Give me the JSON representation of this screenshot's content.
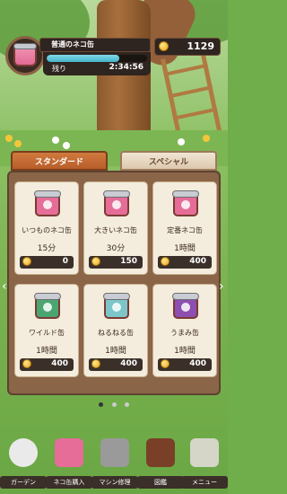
{
  "header": {
    "can_title": "普通のネコ缶",
    "remaining_label": "残り",
    "remaining_time": "2:34:56",
    "progress": 0.72,
    "coins": "1129"
  },
  "tabs": [
    {
      "label": "スタンダード",
      "active": true
    },
    {
      "label": "スペシャル",
      "active": false
    }
  ],
  "items": [
    {
      "name": "いつものネコ缶",
      "time": "15分",
      "price": "0",
      "color": "#e56d98"
    },
    {
      "name": "大きいネコ缶",
      "time": "30分",
      "price": "150",
      "color": "#e56d98"
    },
    {
      "name": "定番ネコ缶",
      "time": "1時間",
      "price": "400",
      "color": "#e56d98"
    },
    {
      "name": "ワイルド缶",
      "time": "1時間",
      "price": "400",
      "color": "#4aa571"
    },
    {
      "name": "ねるねる缶",
      "time": "1時間",
      "price": "400",
      "color": "#7cc6c9"
    },
    {
      "name": "うまみ缶",
      "time": "1時間",
      "price": "400",
      "color": "#8d4fb0"
    }
  ],
  "pagination": {
    "pages": 3,
    "active": 1
  },
  "nav": [
    {
      "label": "ガーデン",
      "icon": "cat-icon"
    },
    {
      "label": "ネコ缶購入",
      "icon": "can-shop-icon"
    },
    {
      "label": "マシン修理",
      "icon": "machine-icon"
    },
    {
      "label": "図鑑",
      "icon": "book-icon"
    },
    {
      "label": "メニュー",
      "icon": "menu-icon"
    }
  ]
}
